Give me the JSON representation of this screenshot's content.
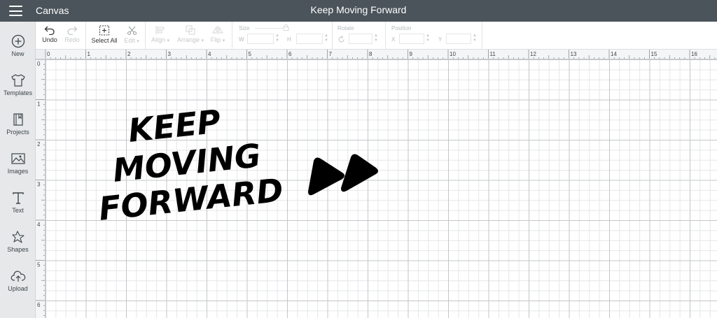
{
  "app": {
    "name": "Canvas",
    "project_title": "Keep Moving Forward"
  },
  "sidebar": {
    "items": [
      {
        "label": "New",
        "icon": "plus-circle-icon"
      },
      {
        "label": "Templates",
        "icon": "tshirt-icon"
      },
      {
        "label": "Projects",
        "icon": "book-icon"
      },
      {
        "label": "Images",
        "icon": "image-icon"
      },
      {
        "label": "Text",
        "icon": "text-icon"
      },
      {
        "label": "Shapes",
        "icon": "shapes-icon"
      },
      {
        "label": "Upload",
        "icon": "cloud-upload-icon"
      }
    ]
  },
  "toolbar": {
    "undo": "Undo",
    "redo": "Redo",
    "select_all": "Select All",
    "edit": "Edit",
    "align": "Align",
    "arrange": "Arrange",
    "flip": "Flip",
    "size_label": "Size",
    "size_w": "W",
    "size_h": "H",
    "rotate_label": "Rotate",
    "position_label": "Position",
    "position_x": "X",
    "position_y": "Y"
  },
  "ruler": {
    "top_labels": [
      "0",
      "1",
      "2",
      "3",
      "4",
      "5",
      "6",
      "7",
      "8",
      "9",
      "10",
      "11",
      "12",
      "13",
      "14",
      "15",
      "16"
    ],
    "left_labels": [
      "0",
      "1",
      "2",
      "3",
      "4",
      "5",
      "6"
    ]
  },
  "design": {
    "line1": "KEEP",
    "line2": "MOVING",
    "line3": "FORWARD",
    "fill": "#000000"
  },
  "colors": {
    "titlebar": "#4b545b",
    "sidebar": "#e6e8e9",
    "grid_major": "#c3c6c9",
    "grid_minor": "#e4e6e8"
  }
}
